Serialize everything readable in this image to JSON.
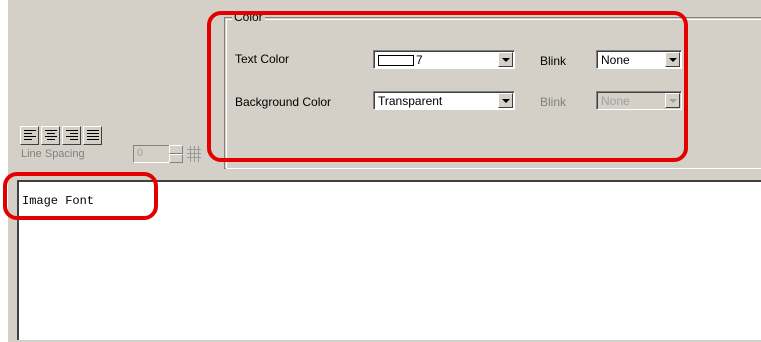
{
  "color_group": {
    "title": "Color",
    "text_color_label": "Text Color",
    "text_color_value": "7",
    "blink_label": "Blink",
    "blink_value": "None",
    "background_color_label": "Background Color",
    "background_color_value": "Transparent",
    "bg_blink_label": "Blink",
    "bg_blink_value": "None"
  },
  "alignment": {
    "icons": [
      "align-left-icon",
      "align-center-icon",
      "align-right-icon",
      "align-justify-icon"
    ]
  },
  "line_spacing": {
    "label": "Line Spacing",
    "value": "0"
  },
  "editor": {
    "content": "Image Font"
  },
  "colors": {
    "highlight": "#e30000",
    "panel": "#d4d0c8"
  }
}
